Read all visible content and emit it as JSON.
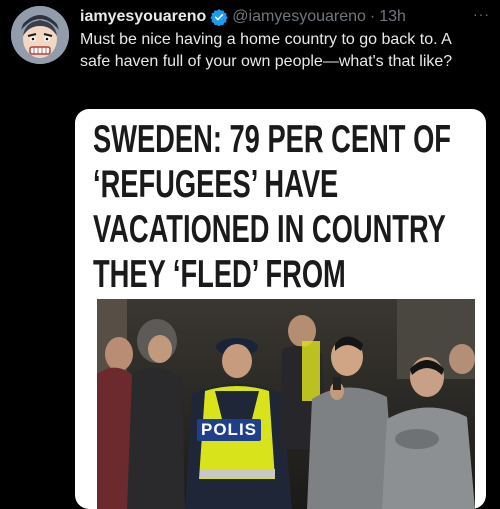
{
  "tweet": {
    "display_name": "iamyesyouareno",
    "handle": "@iamyesyouareno",
    "separator": "·",
    "time": "13h",
    "more": "···",
    "text": "Must be nice having a home country to go back to. A safe haven full of your own people—what's that like?",
    "verified_icon": "verified-badge-icon"
  },
  "card": {
    "headline": "SWEDEN: 79 PER CENT OF ‘REFUGEES’ HAVE VACATIONED IN COUNTRY THEY ‘FLED’ FROM",
    "photo_text": "POLIS"
  },
  "colors": {
    "background": "#000000",
    "text": "#e7e9ea",
    "muted": "#71767b",
    "verified": "#1d9bf0",
    "vest": "#d9e31c"
  }
}
